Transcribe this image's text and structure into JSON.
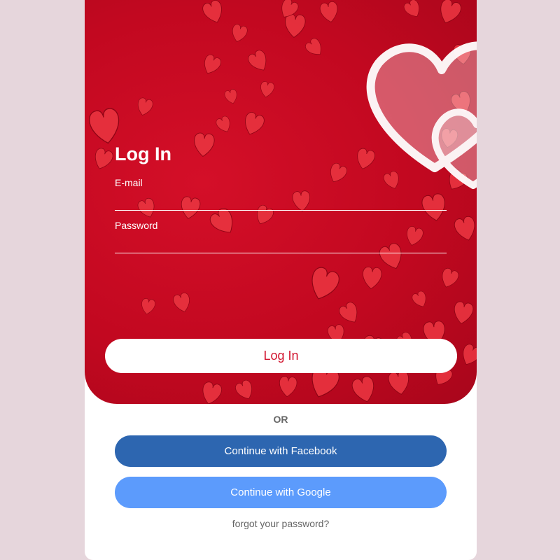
{
  "login": {
    "title": "Log In",
    "email_label": "E-mail",
    "email_value": "",
    "password_label": "Password",
    "password_value": "",
    "submit_label": "Log In"
  },
  "divider_text": "OR",
  "social": {
    "facebook_label": "Continue with Facebook",
    "google_label": "Continue with Google"
  },
  "forgot_label": "forgot your password?",
  "colors": {
    "page_bg": "#e6d6dc",
    "hero_red": "#c20820",
    "submit_text": "#d1122c",
    "facebook": "#2d66b0",
    "google": "#5c9bfc"
  },
  "icons": [
    "double-heart-icon"
  ]
}
